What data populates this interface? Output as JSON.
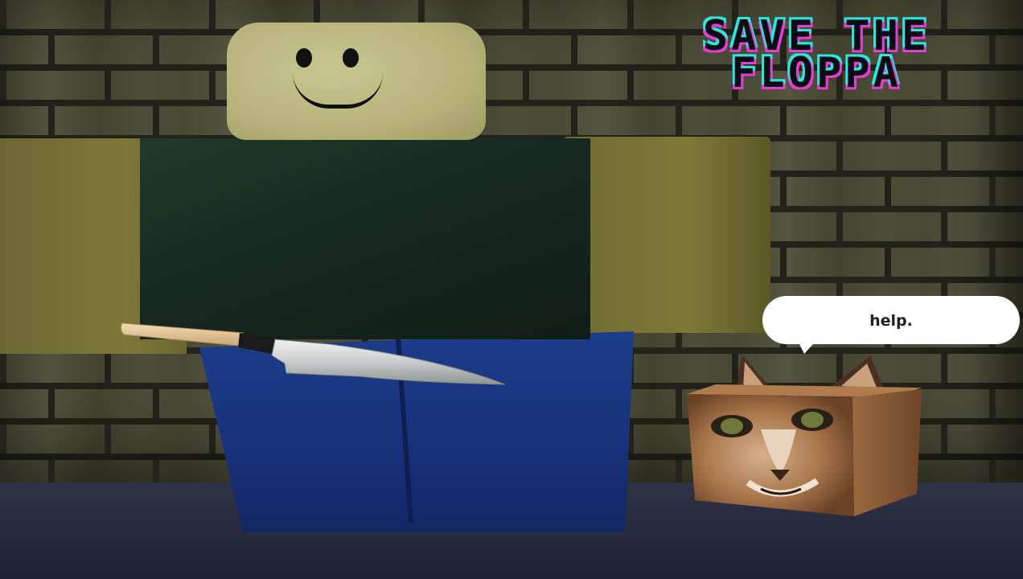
{
  "title": {
    "line1": "SAVE THE",
    "line2": "FLOPPA"
  },
  "speech_bubble": {
    "text": "help."
  },
  "colors": {
    "title_fill": "#0b0b14",
    "title_outline_cyan": "#2ee6e0",
    "title_outline_magenta": "#e23fd0",
    "skin": "#b7b37a",
    "shirt": "#16281f",
    "pants": "#18317a",
    "wall": "#4a4936",
    "floor": "#262a3c"
  }
}
